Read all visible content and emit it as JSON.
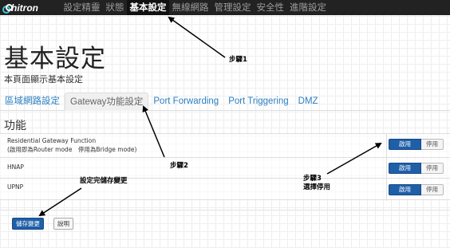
{
  "brand": {
    "logo_text": "hitron"
  },
  "topnav": {
    "items": [
      {
        "label": "設定精靈",
        "active": false
      },
      {
        "label": "狀態",
        "active": false
      },
      {
        "label": "基本設定",
        "active": true
      },
      {
        "label": "無線網路",
        "active": false
      },
      {
        "label": "管理設定",
        "active": false
      },
      {
        "label": "安全性",
        "active": false
      },
      {
        "label": "進階設定",
        "active": false
      }
    ]
  },
  "page": {
    "title": "基本設定",
    "subtitle": "本頁面顯示基本設定"
  },
  "tabs": [
    {
      "label": "區域網路設定",
      "active": false
    },
    {
      "label": "Gateway功能設定",
      "active": true
    },
    {
      "label": "Port Forwarding",
      "active": false
    },
    {
      "label": "Port Triggering",
      "active": false
    },
    {
      "label": "DMZ",
      "active": false
    }
  ],
  "section": {
    "heading": "功能"
  },
  "settings": [
    {
      "label_line1": "Residential Gateway Function",
      "label_line2": "(啟用即為Router mode　停用為Bridge mode)",
      "enable_label": "啟用",
      "disable_label": "停用",
      "state": "enabled"
    },
    {
      "label_line1": "HNAP",
      "label_line2": "",
      "enable_label": "啟用",
      "disable_label": "停用",
      "state": "enabled"
    },
    {
      "label_line1": "UPNP",
      "label_line2": "",
      "enable_label": "啟用",
      "disable_label": "停用",
      "state": "enabled"
    }
  ],
  "actions": {
    "save_label": "儲存變更",
    "help_label": "說明"
  },
  "annotations": {
    "step1": "步驟1",
    "step2": "步驟2",
    "step3_line1": "步驟3",
    "step3_line2": "選擇停用",
    "save_note": "設定完儲存變更"
  },
  "colors": {
    "nav_bg": "#222222",
    "primary": "#1f5fa8",
    "tab_link": "#2a7fc1"
  }
}
